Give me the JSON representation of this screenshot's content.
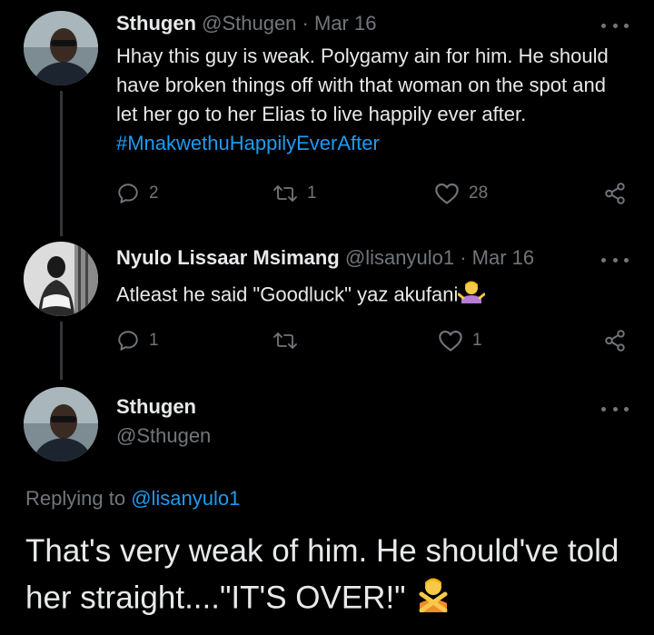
{
  "tweets": [
    {
      "display_name": "Sthugen",
      "handle": "@Sthugen",
      "separator": "·",
      "date": "Mar 16",
      "text": "Hhay this guy is weak. Polygamy ain for him. He should have broken things off with that woman on the spot and let her go to her Elias to live happily ever after.",
      "hashtag": "#MnakwethuHappilyEverAfter",
      "replies": "2",
      "retweets": "1",
      "likes": "28"
    },
    {
      "display_name": "Nyulo Lissaar Msimang",
      "handle": "@lisanyulo1",
      "separator": "·",
      "date": "Mar 16",
      "text": "Atleast he said \"Goodluck\" yaz akufani",
      "emoji": "person-shrugging",
      "replies": "1",
      "retweets": "",
      "likes": "1"
    }
  ],
  "main_tweet": {
    "display_name": "Sthugen",
    "handle": "@Sthugen",
    "replying_prefix": "Replying to",
    "replying_to": "@lisanyulo1",
    "text": "That's very weak of him. He should've told her straight....\"IT'S OVER!\"",
    "emoji": "person-gesturing-no"
  },
  "colors": {
    "background": "#000000",
    "text": "#e7e9ea",
    "muted": "#71767b",
    "accent": "#1d9bf0",
    "thread_line": "#333639"
  }
}
